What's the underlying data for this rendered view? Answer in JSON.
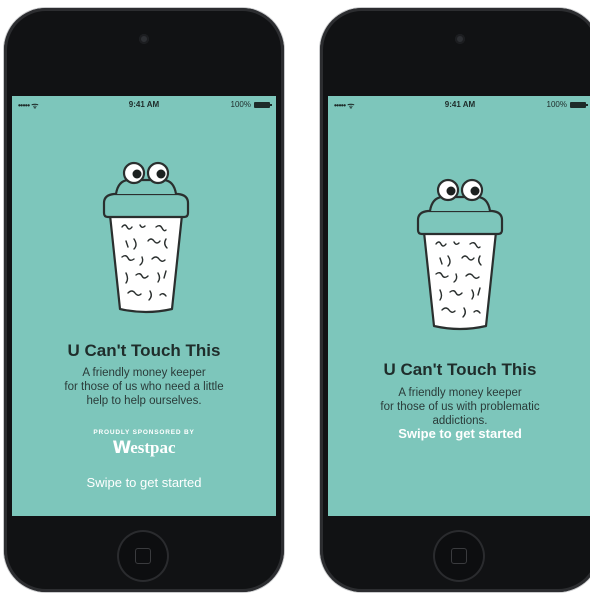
{
  "phones": [
    {
      "status": {
        "signal": "••••• ᯤ",
        "time": "9:41 AM",
        "battery_text": "100%"
      },
      "title": "U Can't Touch This",
      "description": [
        "A friendly money keeper",
        "for those of us who need a little",
        "help to help ourselves."
      ],
      "sponsor": {
        "label": "PROUDLY SPONSORED BY",
        "logo": "estpac",
        "logo_mark": "W"
      },
      "cta": "Swipe to get started"
    },
    {
      "status": {
        "signal": "••••• ᯤ",
        "time": "9:41 AM",
        "battery_text": "100%"
      },
      "title": "U Can't Touch This",
      "description": [
        "A friendly money keeper",
        "for those of us with problematic",
        "addictions."
      ],
      "cta": "Swipe to get started"
    }
  ],
  "colors": {
    "screen_bg": "#7dc6bb",
    "phone_body": "#111214",
    "text_dark": "#1f2d2b",
    "cta": "#ffffff"
  }
}
